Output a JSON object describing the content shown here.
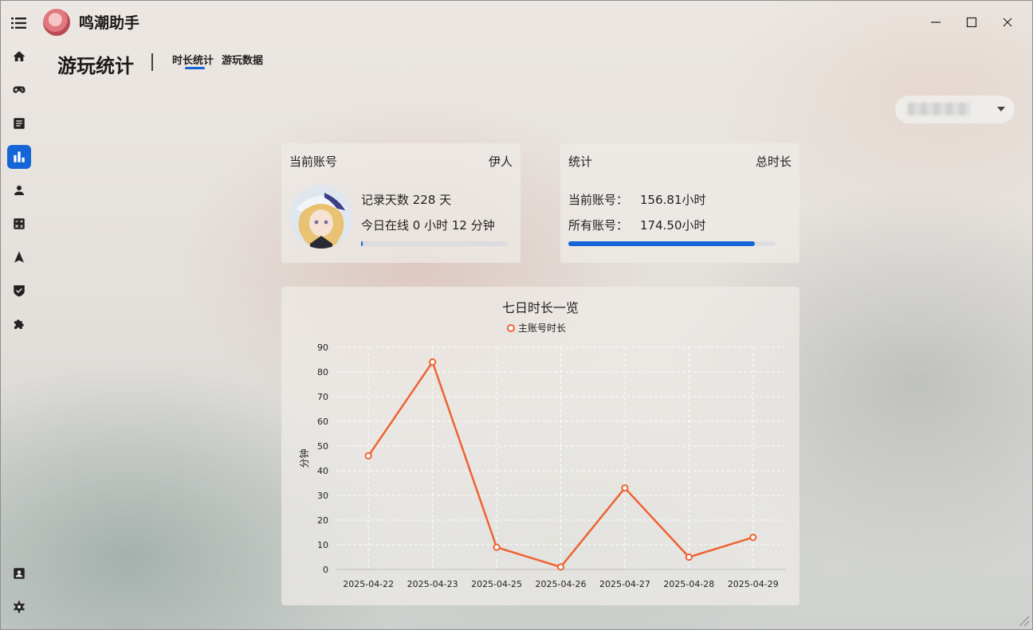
{
  "app": {
    "title": "鸣潮助手"
  },
  "header": {
    "page_title": "游玩统计",
    "tabs": [
      {
        "label": "时长统计",
        "active": true
      },
      {
        "label": "游玩数据",
        "active": false
      }
    ]
  },
  "sidebar": {
    "items": [
      {
        "icon": "home-icon",
        "active": false
      },
      {
        "icon": "gamepad-icon",
        "active": false
      },
      {
        "icon": "document-icon",
        "active": false
      },
      {
        "icon": "bar-chart-icon",
        "active": true
      },
      {
        "icon": "person-icon",
        "active": false
      },
      {
        "icon": "calculator-icon",
        "active": false
      },
      {
        "icon": "navigation-icon",
        "active": false
      },
      {
        "icon": "check-shield-icon",
        "active": false
      },
      {
        "icon": "puzzle-icon",
        "active": false
      }
    ],
    "bottom_items": [
      {
        "icon": "contact-card-icon"
      },
      {
        "icon": "gear-icon"
      }
    ]
  },
  "account_card": {
    "heading": "当前账号",
    "character": "伊人",
    "days_line": "记录天数 228 天",
    "online_line": "今日在线 0 小时 12 分钟",
    "progress": 0.01
  },
  "stats_card": {
    "heading": "统计",
    "label_right": "总时长",
    "current_label": "当前账号：",
    "current_value": "156.81小时",
    "all_label": "所有账号：",
    "all_value": "174.50小时",
    "progress": 0.9
  },
  "colors": {
    "accent": "#1565d8",
    "series": "#ee6233"
  },
  "chart_data": {
    "type": "line",
    "title": "七日时长一览",
    "ylabel": "分钟",
    "xlabel": "",
    "categories": [
      "2025-04-22",
      "2025-04-23",
      "2025-04-25",
      "2025-04-26",
      "2025-04-27",
      "2025-04-28",
      "2025-04-29"
    ],
    "series": [
      {
        "name": "主账号时长",
        "values": [
          46,
          84,
          9,
          1,
          33,
          5,
          13
        ]
      }
    ],
    "ylim": [
      0,
      90
    ],
    "yticks": [
      0,
      10,
      20,
      30,
      40,
      50,
      60,
      70,
      80,
      90
    ],
    "grid": true,
    "legend": "top-center"
  }
}
